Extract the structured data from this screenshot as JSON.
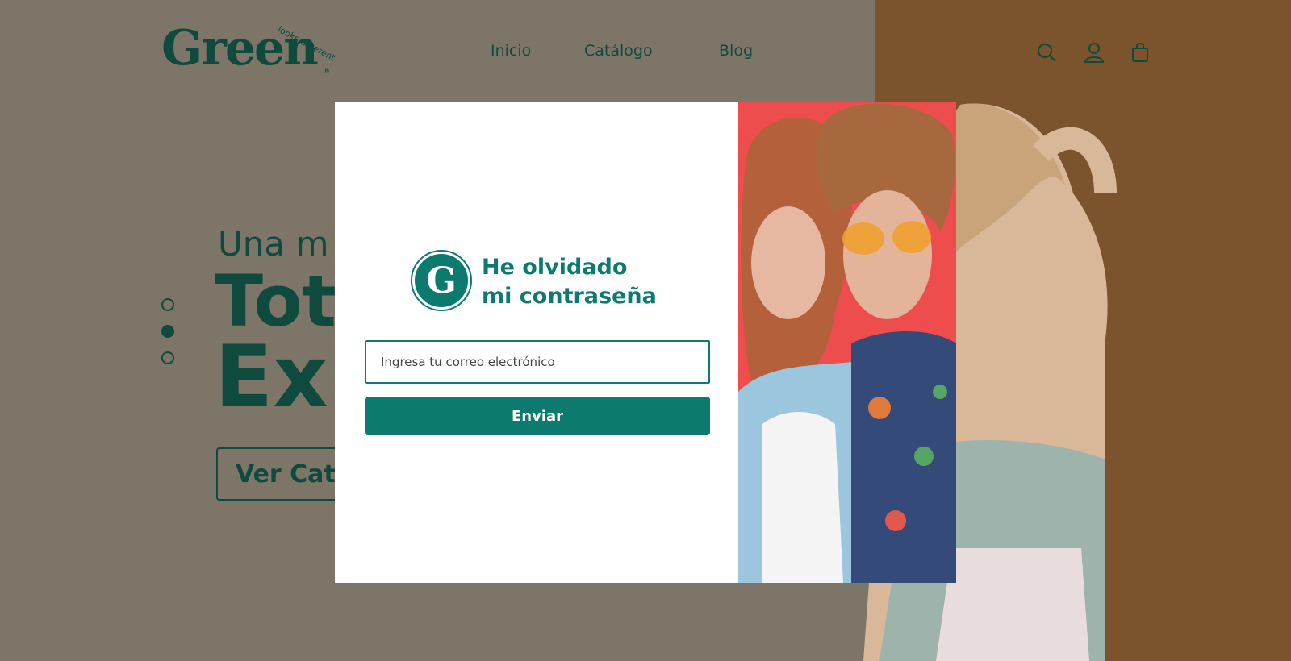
{
  "brand": {
    "logo_text": "Green",
    "tagline": "looks different",
    "registered": "®",
    "badge_letter": "G",
    "colors": {
      "primary": "#0d7a6f",
      "dark": "#0f4a3e",
      "bg_left": "#7d7568",
      "bg_right": "#7b532c"
    }
  },
  "nav": {
    "inicio": "Inicio",
    "catalogo": "Catálogo",
    "blog": "Blog"
  },
  "header_icons": [
    "search-icon",
    "user-icon",
    "shopping-bag-icon"
  ],
  "hero": {
    "subtitle": "Una m",
    "line1": "Tot",
    "line2": "Ex",
    "button": "Ver Cata"
  },
  "slider_dots": {
    "count": 3,
    "active_index": 1
  },
  "modal": {
    "title_line1": "He olvidado",
    "title_line2": "mi contraseña",
    "email_placeholder": "Ingresa tu correo electrónico",
    "email_value": "",
    "submit": "Enviar"
  }
}
